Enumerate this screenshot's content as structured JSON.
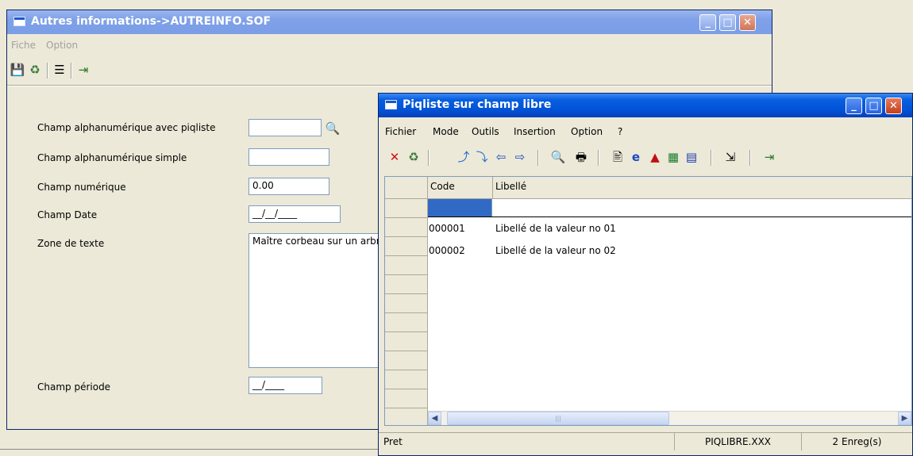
{
  "main_window": {
    "title": "Autres informations->AUTREINFO.SOF",
    "menu": [
      "Fiche",
      "Option"
    ],
    "toolbar": [
      "save-icon",
      "recycle-icon",
      "list-icon",
      "exit-icon"
    ],
    "form": {
      "piqliste_label": "Champ alphanumérique avec piqliste",
      "piqliste_value": "",
      "simple_label": "Champ alphanumérique simple",
      "simple_value": "",
      "numeric_label": "Champ numérique",
      "numeric_value": "0.00",
      "date_label": "Champ Date",
      "date_value": "__/__/____",
      "text_label": "Zone de texte",
      "text_value": "Maître corbeau sur un arbre",
      "period_label": "Champ période",
      "period_value": "__/____"
    }
  },
  "popup_window": {
    "title": "Piqliste  sur champ libre",
    "menu": [
      "Fichier",
      "Mode",
      "Outils",
      "Insertion",
      "Option",
      "?"
    ],
    "toolbar": [
      "delete-icon",
      "recycle-icon",
      "up-icon",
      "down-icon",
      "left-arrow-icon",
      "right-arrow-icon",
      "search-icon",
      "print-icon",
      "preview-icon",
      "internet-explorer-icon",
      "pdf-icon",
      "excel-icon",
      "word-icon",
      "select-icon",
      "exit-icon"
    ],
    "grid": {
      "columns": [
        "Code",
        "Libellé"
      ],
      "rows": [
        {
          "code": "000001",
          "label": "Libellé de la valeur no 01"
        },
        {
          "code": "000002",
          "label": "Libellé de la valeur no 02"
        }
      ]
    },
    "status": {
      "message": "Pret",
      "file": "PIQLIBRE.XXX",
      "count": "2 Enreg(s)"
    }
  }
}
